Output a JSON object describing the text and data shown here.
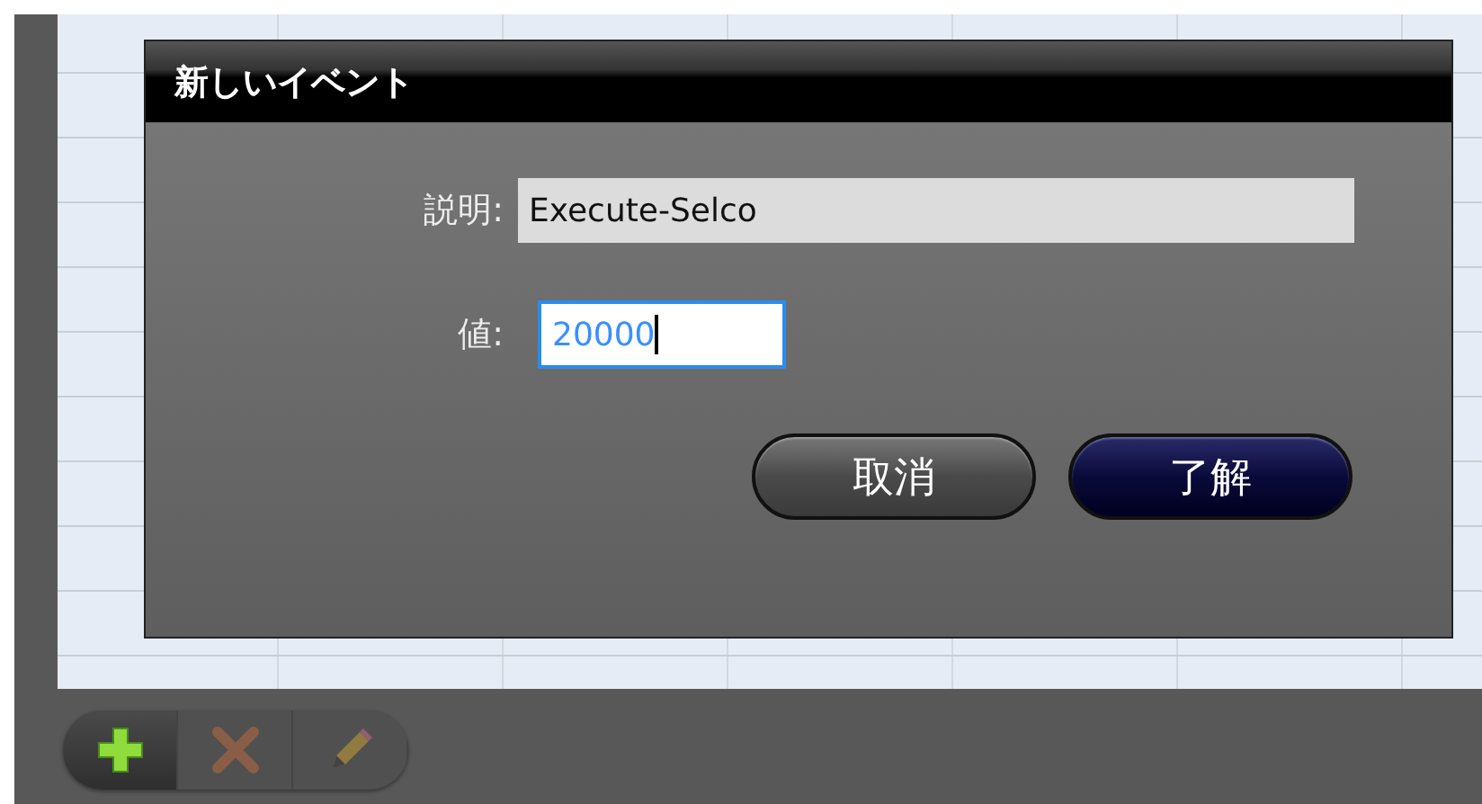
{
  "dialog": {
    "title": "新しいイベント",
    "fields": [
      {
        "label": "説明:",
        "value": "Execute-Selco",
        "focused": false
      },
      {
        "label": "値:",
        "value": "20000",
        "focused": true
      }
    ],
    "buttons": [
      {
        "label": "取消",
        "kind": "secondary"
      },
      {
        "label": "了解",
        "kind": "primary"
      }
    ]
  },
  "toolbar": [
    {
      "kind": "add",
      "disabled": false
    },
    {
      "kind": "delete",
      "disabled": true
    },
    {
      "kind": "edit",
      "disabled": true
    }
  ]
}
